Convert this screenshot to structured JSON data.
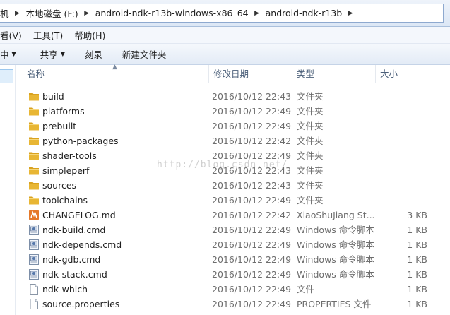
{
  "address": {
    "crumbs": [
      "机",
      "本地磁盘 (F:)",
      "android-ndk-r13b-windows-x86_64",
      "android-ndk-r13b"
    ]
  },
  "menu": {
    "items": [
      "看(V)",
      "工具(T)",
      "帮助(H)"
    ]
  },
  "toolbar": {
    "items": [
      {
        "label": "中",
        "caret": true
      },
      {
        "label": "共享",
        "caret": true
      },
      {
        "label": "刻录",
        "caret": false
      },
      {
        "label": "新建文件夹",
        "caret": false
      }
    ]
  },
  "columns": {
    "name": "名称",
    "date": "修改日期",
    "type": "类型",
    "size": "大小"
  },
  "files": [
    {
      "name": "build",
      "date": "2016/10/12 22:43",
      "type": "文件夹",
      "size": "",
      "icon": "folder-icon"
    },
    {
      "name": "platforms",
      "date": "2016/10/12 22:49",
      "type": "文件夹",
      "size": "",
      "icon": "folder-icon"
    },
    {
      "name": "prebuilt",
      "date": "2016/10/12 22:49",
      "type": "文件夹",
      "size": "",
      "icon": "folder-icon"
    },
    {
      "name": "python-packages",
      "date": "2016/10/12 22:42",
      "type": "文件夹",
      "size": "",
      "icon": "folder-icon"
    },
    {
      "name": "shader-tools",
      "date": "2016/10/12 22:49",
      "type": "文件夹",
      "size": "",
      "icon": "folder-icon"
    },
    {
      "name": "simpleperf",
      "date": "2016/10/12 22:43",
      "type": "文件夹",
      "size": "",
      "icon": "folder-icon"
    },
    {
      "name": "sources",
      "date": "2016/10/12 22:43",
      "type": "文件夹",
      "size": "",
      "icon": "folder-icon"
    },
    {
      "name": "toolchains",
      "date": "2016/10/12 22:49",
      "type": "文件夹",
      "size": "",
      "icon": "folder-icon"
    },
    {
      "name": "CHANGELOG.md",
      "date": "2016/10/12 22:42",
      "type": "XiaoShuJiang St...",
      "size": "3 KB",
      "icon": "markdown-file-icon"
    },
    {
      "name": "ndk-build.cmd",
      "date": "2016/10/12 22:49",
      "type": "Windows 命令脚本",
      "size": "1 KB",
      "icon": "cmd-file-icon"
    },
    {
      "name": "ndk-depends.cmd",
      "date": "2016/10/12 22:49",
      "type": "Windows 命令脚本",
      "size": "1 KB",
      "icon": "cmd-file-icon"
    },
    {
      "name": "ndk-gdb.cmd",
      "date": "2016/10/12 22:49",
      "type": "Windows 命令脚本",
      "size": "1 KB",
      "icon": "cmd-file-icon"
    },
    {
      "name": "ndk-stack.cmd",
      "date": "2016/10/12 22:49",
      "type": "Windows 命令脚本",
      "size": "1 KB",
      "icon": "cmd-file-icon"
    },
    {
      "name": "ndk-which",
      "date": "2016/10/12 22:49",
      "type": "文件",
      "size": "1 KB",
      "icon": "file-icon"
    },
    {
      "name": "source.properties",
      "date": "2016/10/12 22:49",
      "type": "PROPERTIES 文件",
      "size": "1 KB",
      "icon": "file-icon"
    }
  ],
  "watermark": "http://blog.csdn.net/",
  "colors": {
    "folder": "#e8b634",
    "selection": "#dfeefb",
    "header_text": "#4c607a"
  }
}
